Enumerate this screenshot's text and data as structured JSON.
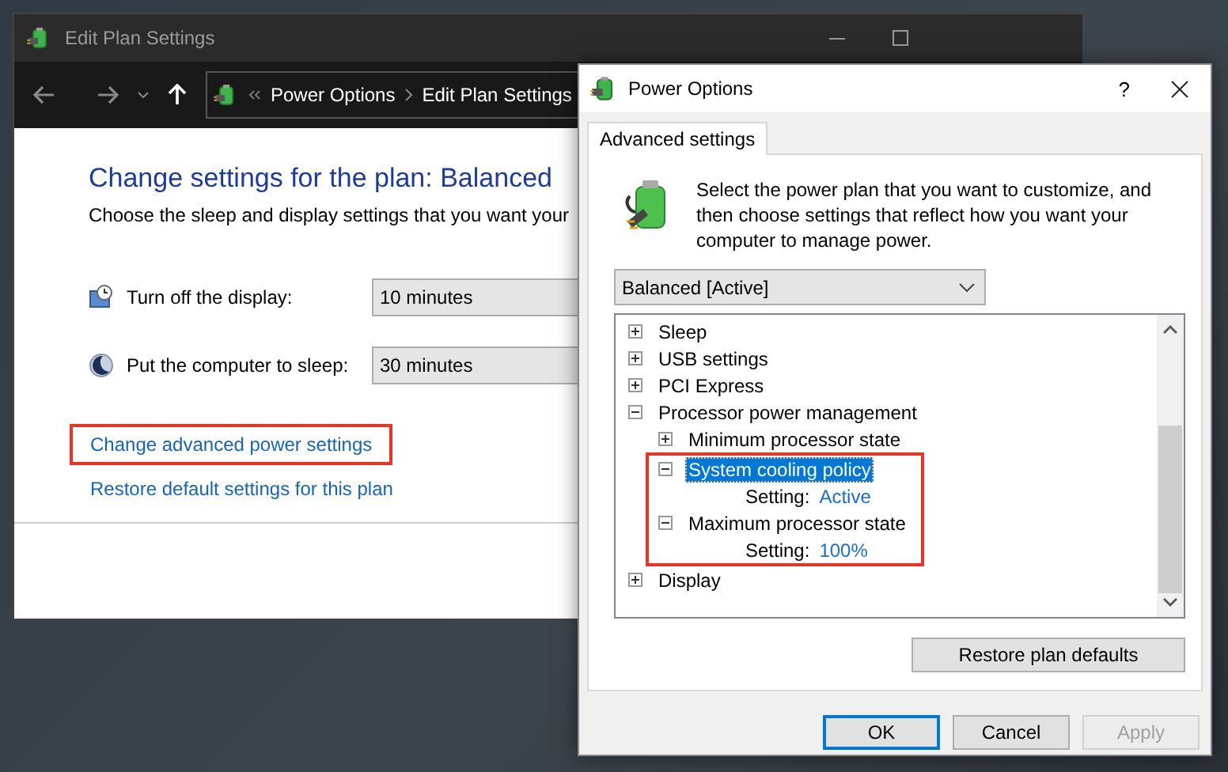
{
  "back_window": {
    "title": "Edit Plan Settings",
    "breadcrumb": [
      "Power Options",
      "Edit Plan Settings"
    ],
    "heading": "Change settings for the plan: Balanced",
    "description": "Choose the sleep and display settings that you want your",
    "settings": [
      {
        "kind": "display",
        "label": "Turn off the display:",
        "value": "10 minutes"
      },
      {
        "kind": "sleep",
        "label": "Put the computer to sleep:",
        "value": "30 minutes"
      }
    ],
    "links": [
      {
        "text": "Change advanced power settings",
        "highlighted": true
      },
      {
        "text": "Restore default settings for this plan",
        "highlighted": false
      }
    ]
  },
  "dialog": {
    "title": "Power Options",
    "help": "?",
    "tabs": [
      {
        "label": "Advanced settings",
        "selected": true
      }
    ],
    "intro": "Select the power plan that you want to customize, and then choose settings that reflect how you want your computer to manage power.",
    "plan": "Balanced [Active]",
    "tree": [
      {
        "kind": "group",
        "label": "Sleep",
        "expanded": false,
        "selected": false,
        "highlighted": false
      },
      {
        "kind": "group",
        "label": "USB settings",
        "expanded": false,
        "selected": false,
        "highlighted": false
      },
      {
        "kind": "group",
        "label": "PCI Express",
        "expanded": false,
        "selected": false,
        "highlighted": false
      },
      {
        "kind": "group",
        "label": "Processor power management",
        "expanded": true,
        "selected": false,
        "highlighted": false,
        "children": [
          {
            "kind": "group",
            "label": "Minimum processor state",
            "expanded": false,
            "selected": false,
            "highlighted": false
          },
          {
            "kind": "group",
            "label": "System cooling policy",
            "expanded": true,
            "selected": true,
            "highlighted": true,
            "children": [
              {
                "kind": "setting",
                "label": "Setting:",
                "value": "Active"
              }
            ]
          },
          {
            "kind": "group",
            "label": "Maximum processor state",
            "expanded": true,
            "selected": false,
            "highlighted": true,
            "children": [
              {
                "kind": "setting",
                "label": "Setting:",
                "value": "100%"
              }
            ]
          }
        ]
      },
      {
        "kind": "group",
        "label": "Display",
        "expanded": false,
        "selected": false,
        "highlighted": false
      }
    ],
    "restore_button": "Restore plan defaults",
    "buttons": [
      {
        "label": "OK",
        "default": true,
        "disabled": false
      },
      {
        "label": "Cancel",
        "default": false,
        "disabled": false
      },
      {
        "label": "Apply",
        "default": false,
        "disabled": true
      }
    ]
  }
}
